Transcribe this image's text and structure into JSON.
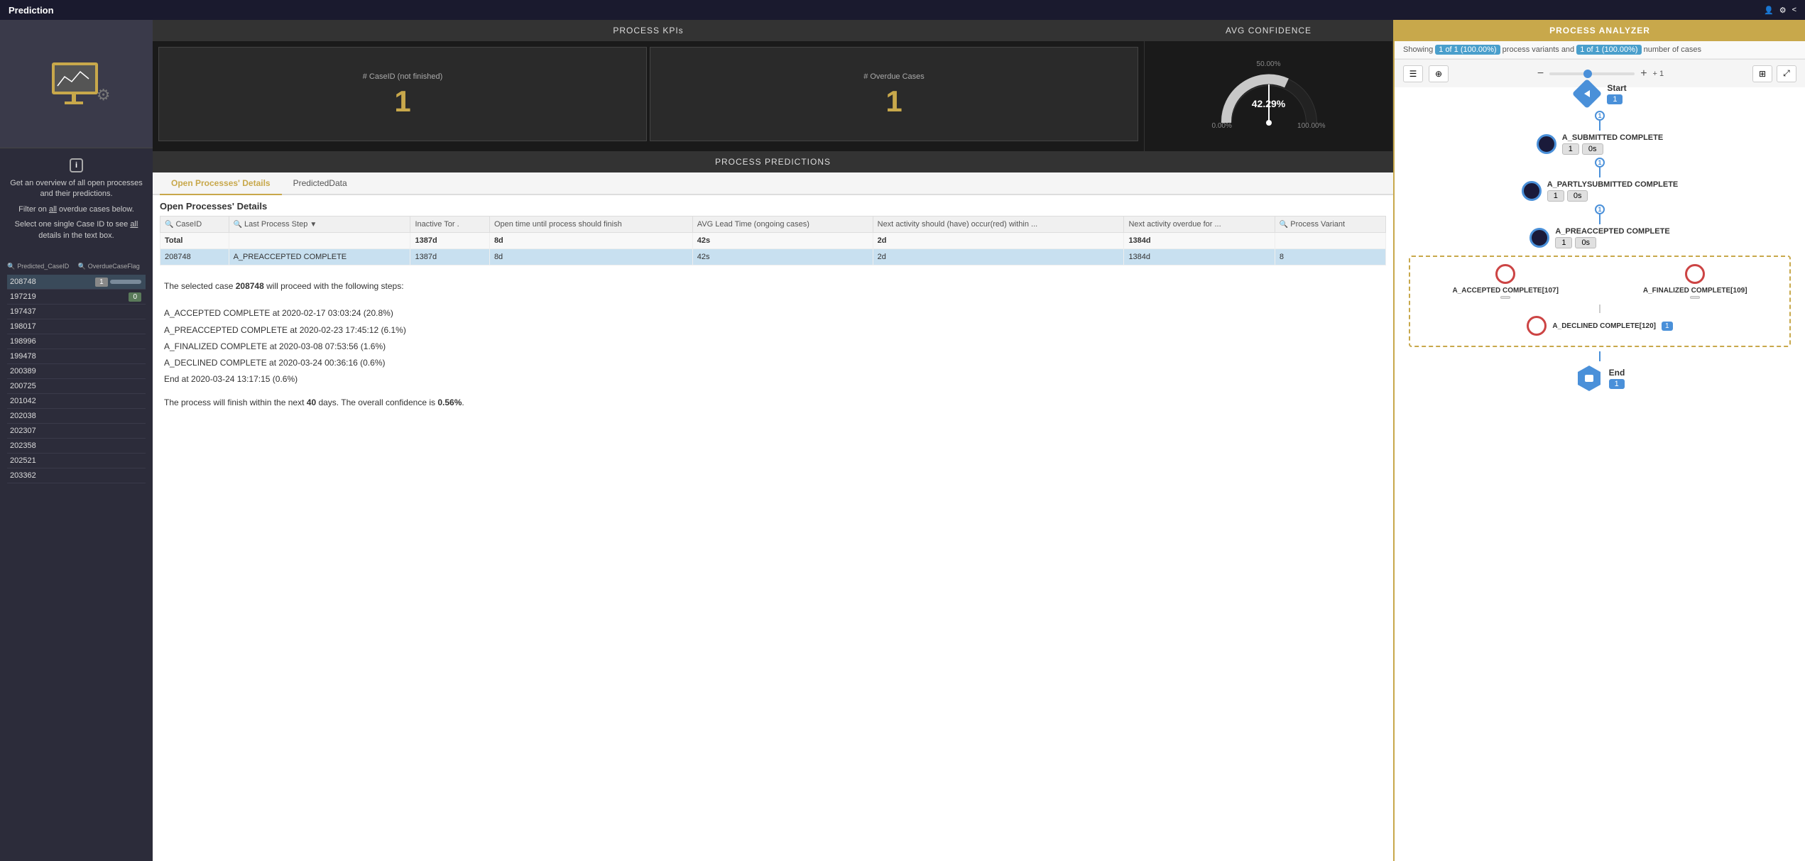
{
  "app": {
    "title": "Prediction"
  },
  "topbar": {
    "title": "Prediction",
    "collapse_label": "<"
  },
  "kpi": {
    "title": "PROCESS KPIs",
    "card1_label": "# CaseID (not finished)",
    "card1_value": "1",
    "card2_label": "# Overdue Cases",
    "card2_value": "1"
  },
  "confidence": {
    "title": "AVG CONFIDENCE",
    "value": "42.29%",
    "min_label": "0.00%",
    "mid_label": "50.00%",
    "max_label": "100.00%"
  },
  "predictions": {
    "title": "PROCESS PREDICTIONS",
    "tab_open": "Open Processes' Details",
    "tab_predicted": "PredictedData",
    "table_title": "Open Processes' Details",
    "columns": [
      "CaseID",
      "Last Process Step",
      "Inactive for ...",
      "Open time until process should finish",
      "AVG Lead Time (ongoing cases)",
      "Next activity should (have) occur(red) within ...",
      "Next activity overdue for ...",
      "Process Variant"
    ],
    "total_row": {
      "caseid": "Total",
      "last_step": "",
      "inactive": "1387d",
      "open_time": "8d",
      "avg_lead": "42s",
      "next_occur": "2d",
      "next_overdue": "1384d",
      "variant": ""
    },
    "data_row": {
      "caseid": "208748",
      "last_step": "A_PREACCEPTED COMPLETE",
      "inactive": "1387d",
      "open_time": "8d",
      "avg_lead": "42s",
      "next_occur": "2d",
      "next_overdue": "1384d",
      "variant": "8"
    },
    "prediction_intro": "The selected case 208748 will proceed with the following steps:",
    "steps": [
      "A_ACCEPTED COMPLETE at 2020-02-17 03:03:24 (20.8%)",
      "A_PREACCEPTED COMPLETE at 2020-02-23 17:45:12 (6.1%)",
      "A_FINALIZED COMPLETE at 2020-03-08 07:53:56 (1.6%)",
      "A_DECLINED COMPLETE at 2020-03-24 00:36:16 (0.6%)",
      "End at 2020-03-24 13:17:15 (0.6%)"
    ],
    "summary": "The process will finish within the next 40 days. The overall confidence is 0.56%."
  },
  "sidebar": {
    "info_text1": "Get an overview of all open processes and their predictions.",
    "info_text2": "Filter on all overdue cases below.",
    "info_text3": "Select one single Case ID to see all details in the text box.",
    "col1": "Predicted_CaseID",
    "col2": "OverdueCaseFlag",
    "rows": [
      {
        "caseid": "208748",
        "flag": "1"
      },
      {
        "caseid": "197219",
        "flag": "0"
      },
      {
        "caseid": "197437",
        "flag": ""
      },
      {
        "caseid": "198017",
        "flag": ""
      },
      {
        "caseid": "198996",
        "flag": ""
      },
      {
        "caseid": "199478",
        "flag": ""
      },
      {
        "caseid": "200389",
        "flag": ""
      },
      {
        "caseid": "200725",
        "flag": ""
      },
      {
        "caseid": "201042",
        "flag": ""
      },
      {
        "caseid": "202038",
        "flag": ""
      },
      {
        "caseid": "202307",
        "flag": ""
      },
      {
        "caseid": "202358",
        "flag": ""
      },
      {
        "caseid": "202521",
        "flag": ""
      },
      {
        "caseid": "203362",
        "flag": ""
      }
    ]
  },
  "analyzer": {
    "title": "PROCESS ANALYZER",
    "subtitle_text": "Showing",
    "variants_label": "1 of 1 (100.00%)",
    "variants_text": "process variants and",
    "cases_label": "1 of 1 (100.00%)",
    "cases_text": "number of cases",
    "nodes": [
      {
        "id": "start",
        "label": "Start",
        "count": "1",
        "type": "diamond"
      },
      {
        "id": "submitted",
        "label": "A_SUBMITTED COMPLETE",
        "count": "1",
        "time": "0s",
        "type": "circle"
      },
      {
        "id": "partly",
        "label": "A_PARTLYSUBMITTED COMPLETE",
        "count": "1",
        "time": "0s",
        "type": "circle"
      },
      {
        "id": "preaccepted",
        "label": "A_PREACCEPTED COMPLETE",
        "count": "1",
        "time": "0s",
        "type": "circle"
      },
      {
        "id": "accepted",
        "label": "A_ACCEPTED COMPLETE[107]",
        "type": "circle-red"
      },
      {
        "id": "finalized",
        "label": "A_FINALIZED COMPLETE[109]",
        "type": "circle-red"
      },
      {
        "id": "declined",
        "label": "A_DECLINED COMPLETE[120]",
        "type": "circle-red"
      },
      {
        "id": "end",
        "label": "End",
        "count": "1",
        "type": "hexagon"
      }
    ]
  }
}
